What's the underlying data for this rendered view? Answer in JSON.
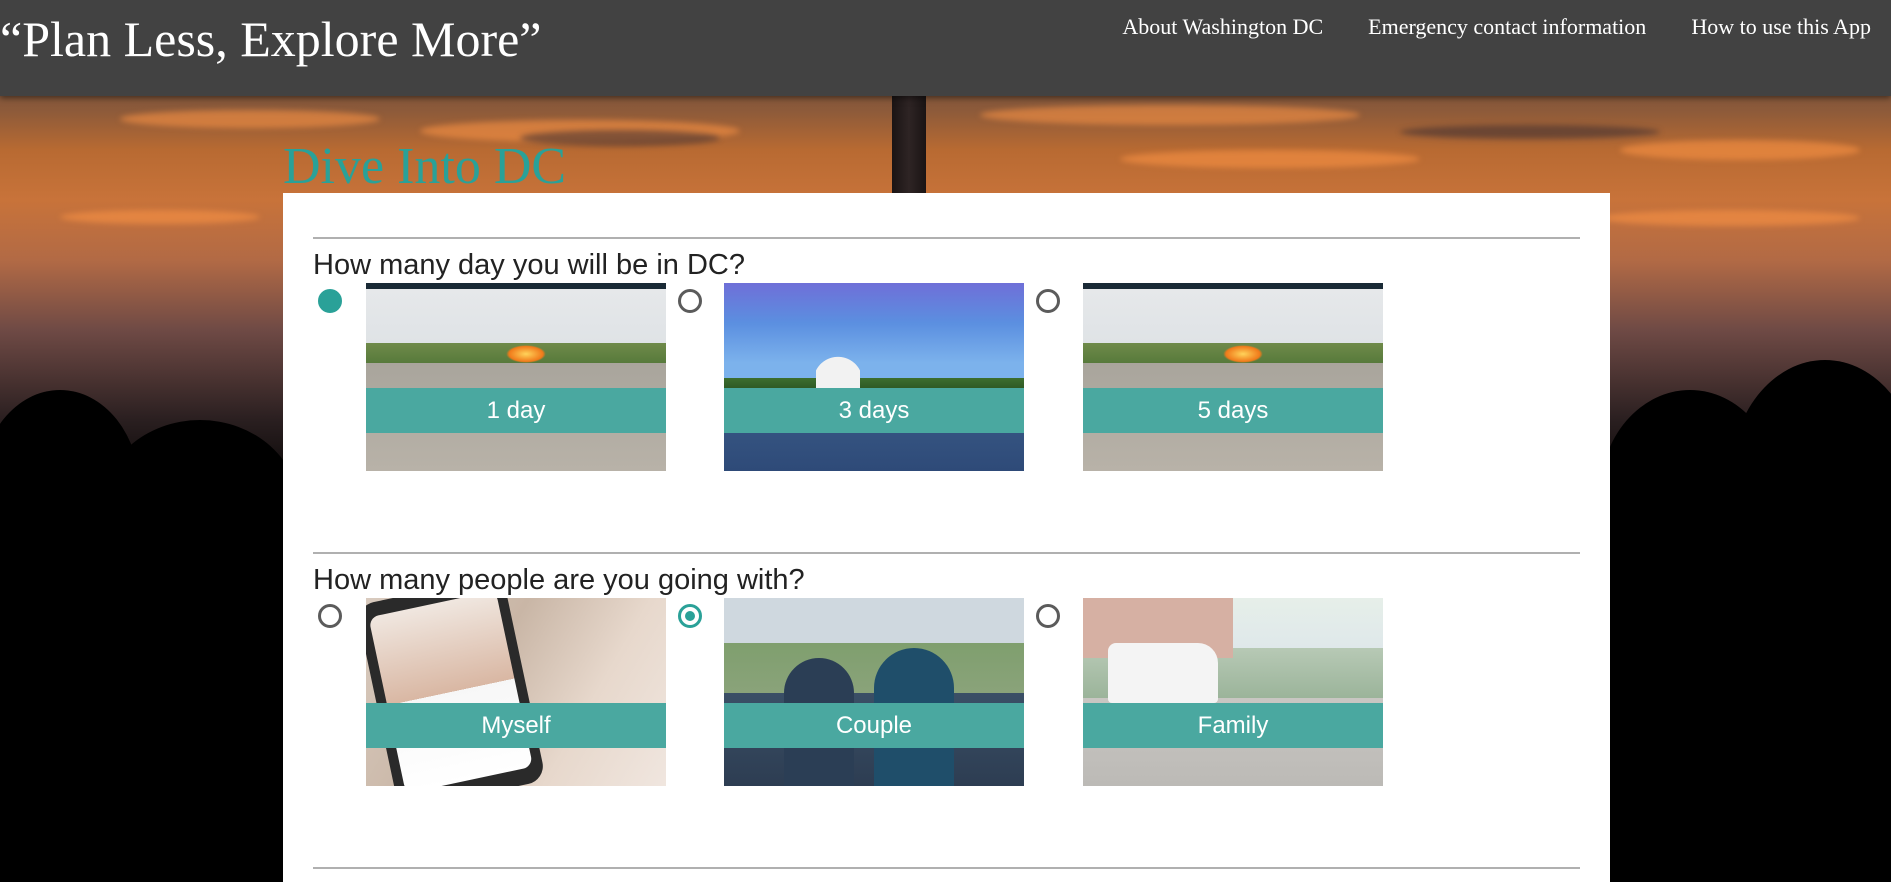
{
  "header": {
    "brand": "“Plan Less, Explore More”",
    "nav": [
      {
        "label": "About Washington DC"
      },
      {
        "label": "Emergency contact information"
      },
      {
        "label": "How to use this App"
      }
    ]
  },
  "page_title": "Dive Into DC",
  "questions": [
    {
      "text": "How many day you will be in DC?",
      "options": [
        {
          "label": "1 day",
          "image": "eternal-flame",
          "selected": true
        },
        {
          "label": "3 days",
          "image": "capitol-building",
          "selected": false
        },
        {
          "label": "5 days",
          "image": "eternal-flame",
          "selected": false
        }
      ]
    },
    {
      "text": "How many people are you going with?",
      "options": [
        {
          "label": "Myself",
          "image": "phone-app",
          "selected": false
        },
        {
          "label": "Couple",
          "image": "couple-walking",
          "selected": true
        },
        {
          "label": "Family",
          "image": "family-street",
          "selected": false
        }
      ]
    }
  ],
  "colors": {
    "accent": "#2aa198",
    "label_band": "#4aa8a0",
    "header_bg": "#424242"
  }
}
